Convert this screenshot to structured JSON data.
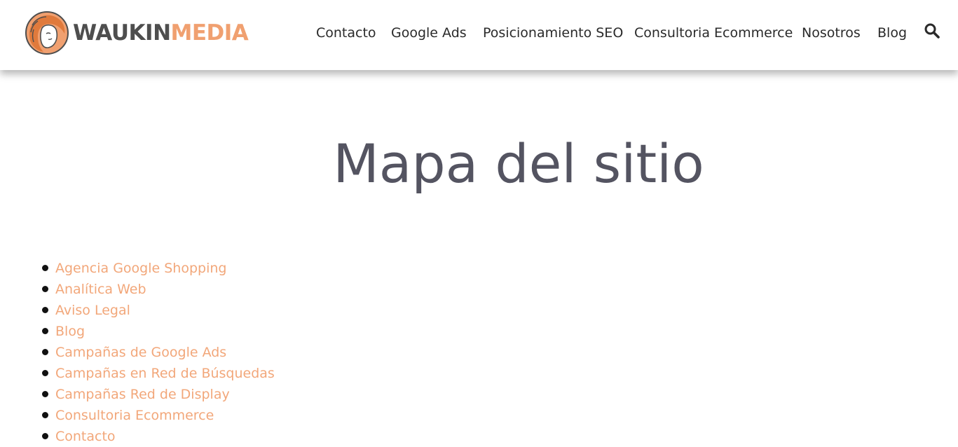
{
  "header": {
    "logo": {
      "text_part1": "WAUKIN",
      "text_part2": "MEDIA",
      "brand_dark": "#4e4e4e",
      "brand_accent": "#f0a070",
      "icon": "woman-face-logo-icon"
    },
    "nav": [
      {
        "label": "Contacto"
      },
      {
        "label": "Google Ads"
      },
      {
        "label": "Posicionamiento SEO"
      },
      {
        "label": "Consultoria Ecommerce"
      },
      {
        "label": "Nosotros"
      },
      {
        "label": "Blog"
      }
    ],
    "search_icon": "search-icon"
  },
  "main": {
    "title": "Mapa del sitio",
    "title_color": "#545461",
    "link_color": "#f2a77a",
    "links": [
      {
        "label": "Agencia Google Shopping"
      },
      {
        "label": "Analítica Web"
      },
      {
        "label": "Aviso Legal"
      },
      {
        "label": "Blog"
      },
      {
        "label": "Campañas de Google Ads"
      },
      {
        "label": "Campañas en Red de Búsquedas"
      },
      {
        "label": "Campañas Red de Display"
      },
      {
        "label": "Consultoria Ecommerce"
      },
      {
        "label": "Contacto"
      }
    ]
  }
}
